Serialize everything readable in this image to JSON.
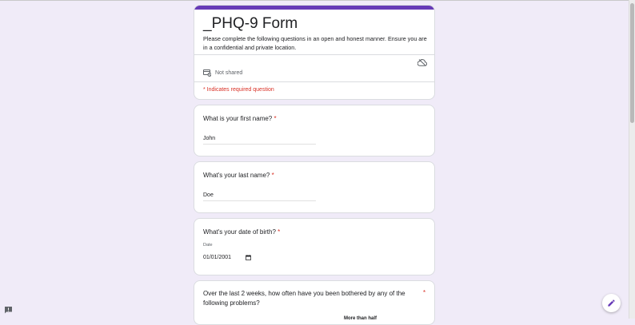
{
  "form": {
    "title": "_PHQ-9 Form",
    "description": "Please complete the following questions in an open and honest manner. Ensure you are in a confidential and private location.",
    "share_status": "Not shared",
    "required_note": "* Indicates required question"
  },
  "questions": [
    {
      "title": "What is your first name?",
      "required_mark": "*",
      "answer": "John"
    },
    {
      "title": "What's your last name?",
      "required_mark": "*",
      "answer": "Doe"
    },
    {
      "title": "What's your date of birth?",
      "required_mark": "*",
      "field_label": "Date",
      "answer": "01/01/2001"
    },
    {
      "title": "Over the last 2 weeks, how often have you been bothered by any of the following problems?",
      "required_mark": "*",
      "column_header": "More than half"
    }
  ],
  "colors": {
    "accent": "#673ab7",
    "background": "#f0ebf8",
    "required": "#d93025"
  },
  "icons": [
    "cloud-icon",
    "share-status-icon",
    "calendar-icon",
    "report-icon",
    "edit-icon"
  ]
}
